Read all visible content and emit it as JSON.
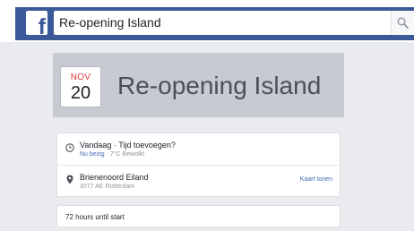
{
  "topbar": {
    "logo_letter": "f",
    "search_value": "Re-opening Island",
    "search_icon": "search-icon"
  },
  "event": {
    "month": "NOV",
    "day": "20",
    "title": "Re-opening Island"
  },
  "time_row": {
    "icon": "clock-icon",
    "main": "Vandaag · Tijd toevoegen?",
    "status": "Nu bezig",
    "weather": " · 7°C Bewolkt"
  },
  "location_row": {
    "icon": "map-pin-icon",
    "name": "Brienenoord Eiland",
    "address": "3077 AE Rotterdam",
    "map_link": "Kaart tonen"
  },
  "countdown": {
    "text": "72 hours until start"
  },
  "colors": {
    "facebook_blue": "#3b5998",
    "link_blue": "#4267b2",
    "month_red": "#e0393e"
  }
}
